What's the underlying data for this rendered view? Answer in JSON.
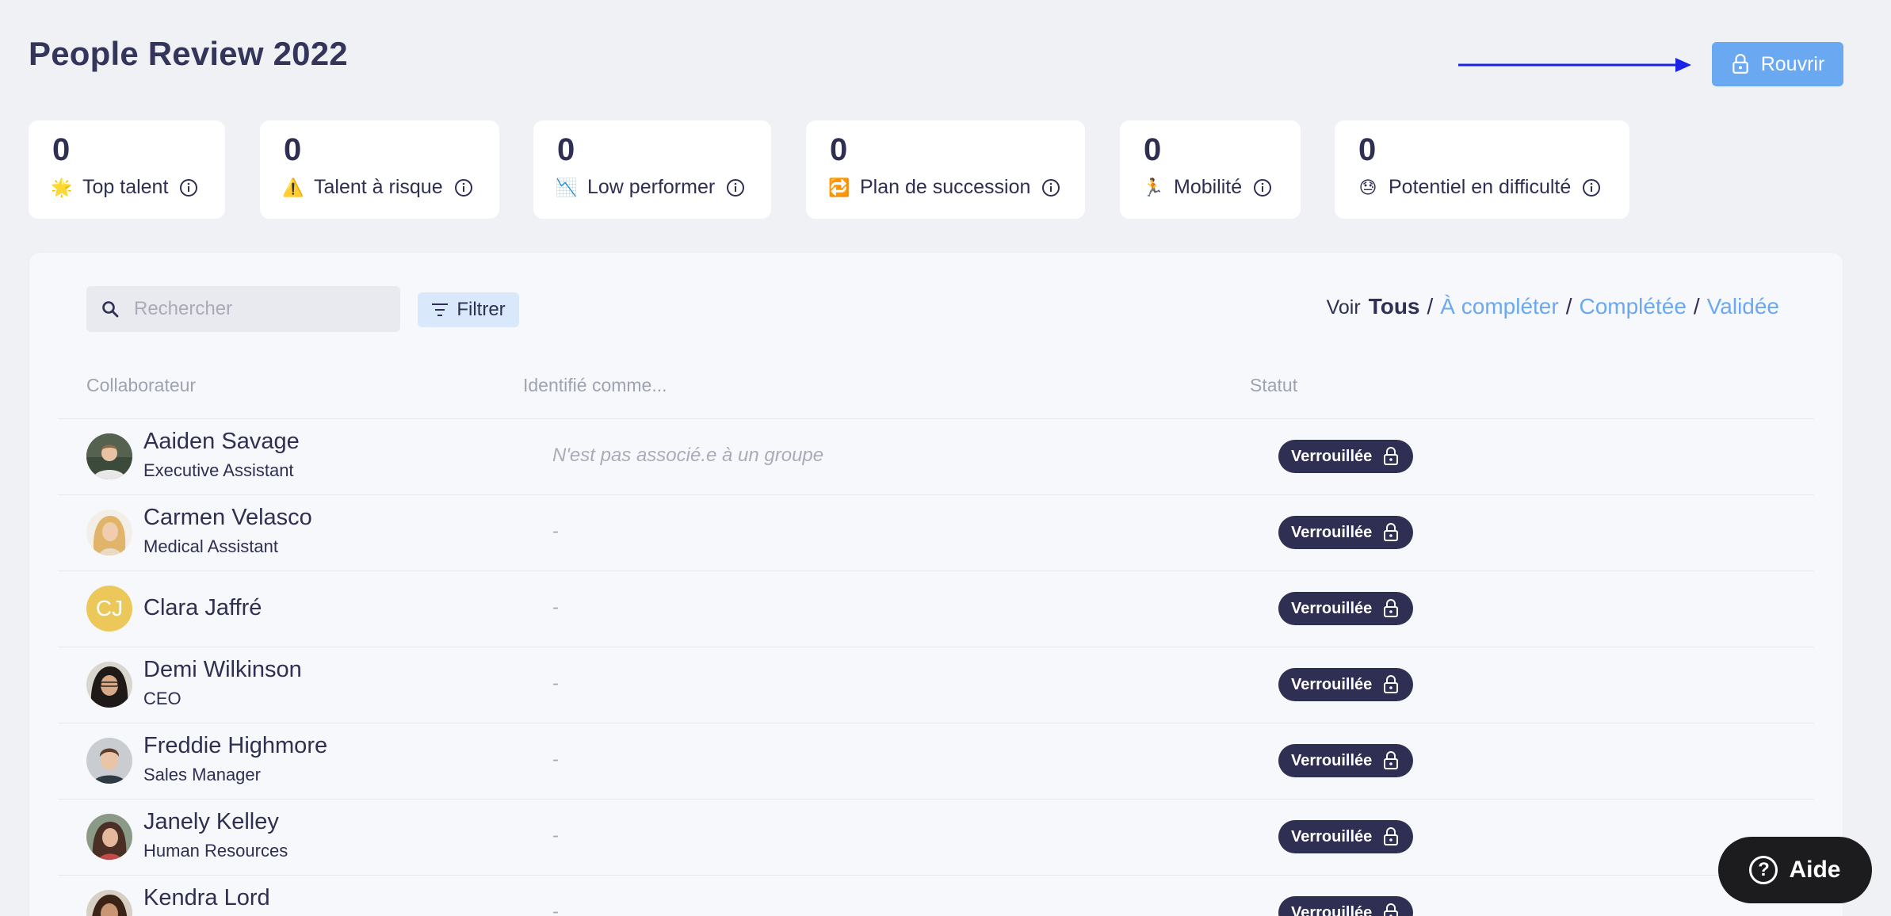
{
  "header": {
    "title": "People Review 2022",
    "reopen_label": "Rouvrir"
  },
  "stats": [
    {
      "value": "0",
      "label": "Top talent",
      "emoji": "🌟",
      "icon": "star-icon"
    },
    {
      "value": "0",
      "label": "Talent à risque",
      "emoji": "⚠️",
      "icon": "warning-icon"
    },
    {
      "value": "0",
      "label": "Low performer",
      "emoji": "📉",
      "icon": "chart-down-icon"
    },
    {
      "value": "0",
      "label": "Plan de succession",
      "emoji": "🔁",
      "icon": "repeat-icon"
    },
    {
      "value": "0",
      "label": "Mobilité",
      "emoji": "🏃",
      "icon": "runner-icon"
    },
    {
      "value": "0",
      "label": "Potentiel en difficulté",
      "emoji": "😓",
      "icon": "sad-face-icon"
    }
  ],
  "toolbar": {
    "search_placeholder": "Rechercher",
    "filter_label": "Filtrer",
    "view_label": "Voir",
    "views": [
      "Tous",
      "À compléter",
      "Complétée",
      "Validée"
    ],
    "view_separator": "/"
  },
  "table": {
    "columns": [
      "Collaborateur",
      "Identifié comme...",
      "Statut"
    ],
    "rows": [
      {
        "name": "Aaiden Savage",
        "role": "Executive Assistant",
        "group": "N'est pas associé.e à un groupe",
        "status": "Verrouillée"
      },
      {
        "name": "Carmen Velasco",
        "role": "Medical Assistant",
        "group": "-",
        "status": "Verrouillée"
      },
      {
        "name": "Clara Jaffré",
        "role": "",
        "initials": "CJ",
        "group": "-",
        "status": "Verrouillée"
      },
      {
        "name": "Demi Wilkinson",
        "role": "CEO",
        "group": "-",
        "status": "Verrouillée"
      },
      {
        "name": "Freddie Highmore",
        "role": "Sales Manager",
        "group": "-",
        "status": "Verrouillée"
      },
      {
        "name": "Janely Kelley",
        "role": "Human Resources",
        "group": "-",
        "status": "Verrouillée"
      },
      {
        "name": "Kendra Lord",
        "role": "",
        "group": "-",
        "status": "Verrouillée"
      }
    ]
  },
  "help": {
    "label": "Aide"
  },
  "colors": {
    "accent": "#6aa8f2",
    "badge": "#2e2f52",
    "arrow": "#1a24e6"
  }
}
